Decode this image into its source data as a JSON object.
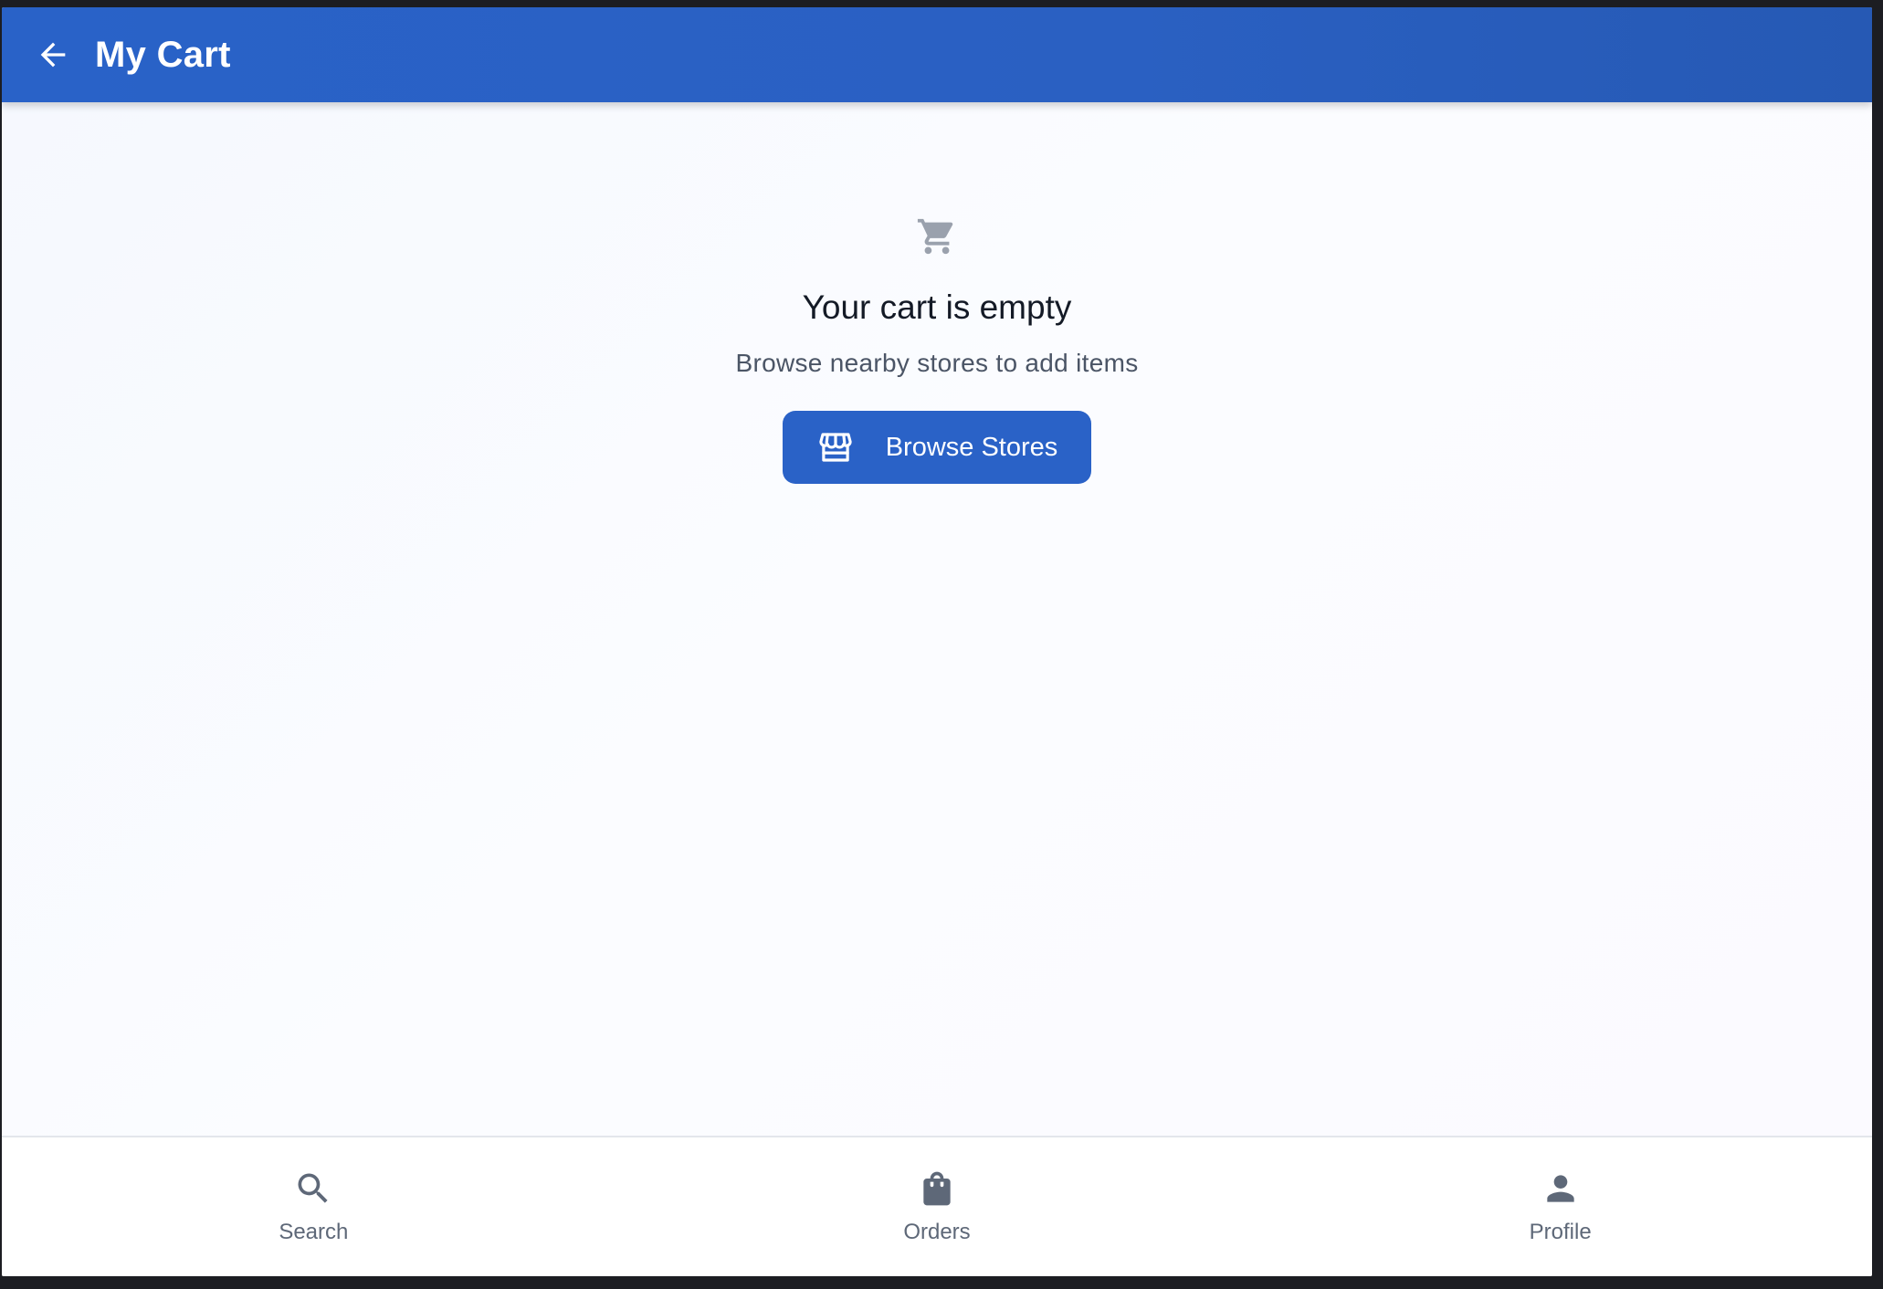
{
  "appbar": {
    "title": "My Cart",
    "back_icon": "arrow-left-icon"
  },
  "empty_state": {
    "icon": "shopping-cart-icon",
    "title": "Your cart is empty",
    "subtitle": "Browse nearby stores to add items",
    "button": {
      "label": "Browse Stores",
      "icon": "storefront-icon"
    }
  },
  "bottom_nav": {
    "items": [
      {
        "label": "Search",
        "icon": "search-icon"
      },
      {
        "label": "Orders",
        "icon": "shopping-bag-icon"
      },
      {
        "label": "Profile",
        "icon": "person-icon"
      }
    ]
  },
  "colors": {
    "primary": "#2a62c7",
    "title_text": "#141a26",
    "muted_text": "#4b5566",
    "nav_icon": "#5e6878",
    "cart_icon": "#9aa1ad"
  }
}
